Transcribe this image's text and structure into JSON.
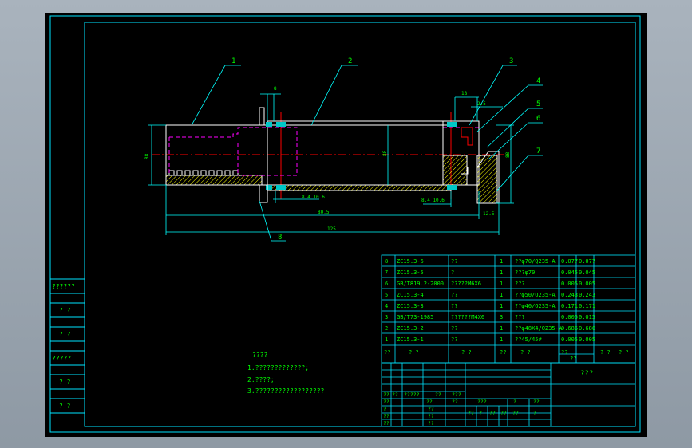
{
  "colors": {
    "viewport_bg": "#000000",
    "frame": "#00e5ff",
    "text": "#00ff00",
    "part": "#ffffff",
    "hidden": "#ff00ff",
    "center": "#ff0000",
    "hatch": "#ffff00",
    "seal": "#00c8c8"
  },
  "balloons": [
    "1",
    "2",
    "3",
    "4",
    "5",
    "6",
    "7",
    "8"
  ],
  "dimensions": {
    "d1": "8",
    "d2": "88",
    "d3": "18",
    "d4": "8.4 10.6",
    "d5": "8.4 10.6",
    "d6": "2.5",
    "d7": "88",
    "d8": "80.5",
    "d9": "125",
    "d10": "12.5",
    "d11": "88"
  },
  "notes": {
    "title": "????",
    "lines": [
      "1.?????????????;",
      "2.????;",
      "3.??????????????????"
    ]
  },
  "side_labels": [
    "??????",
    "? ?",
    "? ?",
    "?????",
    "? ?",
    "? ?"
  ],
  "bom": [
    [
      "8",
      "ZC15.3-6",
      "??",
      "1",
      "??φ70/Q235-A",
      "0.077",
      "0.077"
    ],
    [
      "7",
      "ZC15.3-5",
      "?",
      "1",
      "???φ70",
      "0.045",
      "0.045"
    ],
    [
      "6",
      "GB/T819.2-2000",
      "?????M6X6",
      "1",
      "???",
      "0.005",
      "0.005"
    ],
    [
      "5",
      "ZC15.3-4",
      "??",
      "1",
      "??φ50/Q235-A",
      "0.243",
      "0.243"
    ],
    [
      "4",
      "ZC15.3-3",
      "??",
      "1",
      "??φ40/Q235-A",
      "0.171",
      "0.171"
    ],
    [
      "3",
      "GB/T73-1985",
      "??????M4X6",
      "3",
      "???",
      "0.005",
      "0.015"
    ],
    [
      "2",
      "ZC15.3-2",
      "??",
      "1",
      "??φ48X4/Q235-A",
      "0.686",
      "0.686"
    ],
    [
      "1",
      "ZC15.3-1",
      "??",
      "1",
      "??45/45#",
      "0.005",
      "0.005"
    ]
  ],
  "bom_header": [
    "??",
    "?  ?",
    "?  ?",
    "??",
    "?  ?",
    "??",
    "?  ?",
    "?  ?"
  ],
  "bom_header_sub": "??",
  "title_block": {
    "drawing_name": "???",
    "row1": [
      "??",
      "??",
      "?????",
      "??",
      "???"
    ],
    "row2": [
      "??",
      "??",
      "??"
    ],
    "row3": [
      "???",
      "?",
      "??",
      "??",
      "?"
    ],
    "row4": [
      "?",
      "??",
      "??",
      "?",
      "??",
      "??"
    ],
    "row5": [
      "??",
      "??"
    ],
    "row6": [
      "??",
      "??"
    ]
  }
}
